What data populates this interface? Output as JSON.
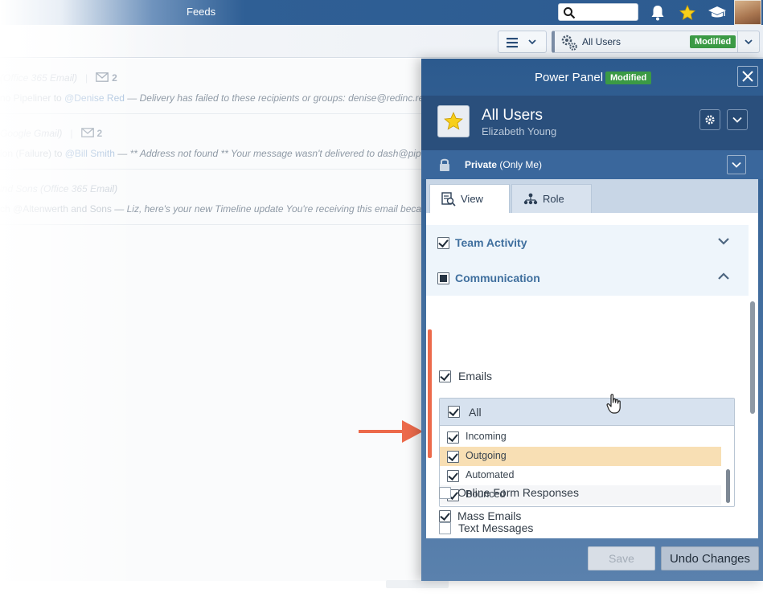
{
  "topbar": {
    "title": "Feeds"
  },
  "toolbar": {
    "view_name": "All Users",
    "modified": "Modified"
  },
  "feed": {
    "rows": [
      {
        "source": "(Office 365 Email)",
        "count": "2",
        "who": "no Pipeliner to",
        "mention": "@Denise Red",
        "text": " — Delivery has failed to these recipients or groups: denise@redinc.re"
      },
      {
        "source": "Google Gmail)",
        "count": "2",
        "who": "ion (Failure) to",
        "mention": "@Bill Smith",
        "text": " — ** Address not found ** Your message wasn't delivered to dash@pip"
      },
      {
        "source": "ind Sons (Office 365 Email)",
        "count": "",
        "who": "ch @Altenwerth and Sons",
        "mention": "",
        "text": " — Liz, here's your new Timeline update You're receiving this email becau"
      }
    ]
  },
  "panel": {
    "title": "Power Panel",
    "modified": "Modified",
    "user_name": "All Users",
    "user_sub": "Elizabeth Young",
    "privacy_bold": "Private",
    "privacy_rest": " (Only Me)",
    "tabs": [
      {
        "label": "View"
      },
      {
        "label": "Role"
      }
    ],
    "sections": {
      "team_activity": "Team Activity",
      "communication": "Communication"
    },
    "options": {
      "emails": "Emails",
      "all": "All",
      "incoming": "Incoming",
      "outgoing": "Outgoing",
      "automated": "Automated",
      "bounced": "Bounced",
      "text_messages": "Text Messages",
      "online_form": "Online Form Responses",
      "mass_emails": "Mass Emails"
    },
    "footer": {
      "save": "Save",
      "undo": "Undo Changes"
    }
  },
  "colors": {
    "accent": "#2c5a8e",
    "modified_badge": "#3b9a45",
    "highlight": "#f8dfb4",
    "annotation": "#ec6a4b"
  }
}
